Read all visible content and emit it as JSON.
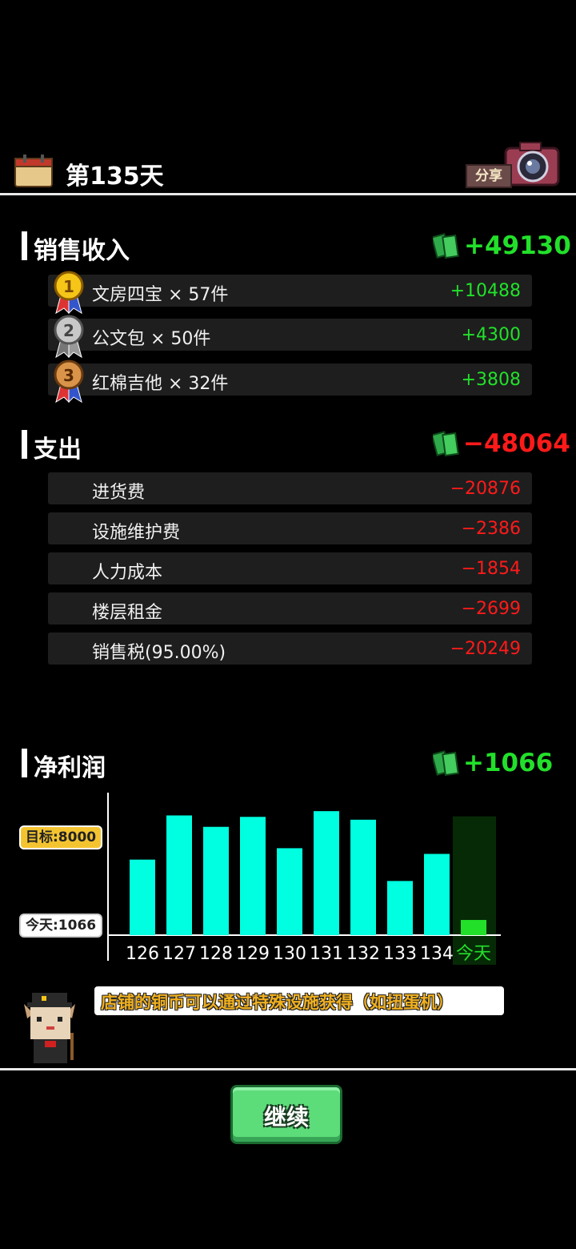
{
  "header": {
    "day_title": "第135天",
    "share_label": "分享"
  },
  "income": {
    "title": "销售收入",
    "total": "+49130",
    "items": [
      {
        "rank": "1",
        "label": "文房四宝 × 57件",
        "value": "+10488"
      },
      {
        "rank": "2",
        "label": "公文包 × 50件",
        "value": "+4300"
      },
      {
        "rank": "3",
        "label": "红棉吉他 × 32件",
        "value": "+3808"
      }
    ]
  },
  "expense": {
    "title": "支出",
    "total": "−48064",
    "items": [
      {
        "label": "进货费",
        "value": "−20876"
      },
      {
        "label": "设施维护费",
        "value": "−2386"
      },
      {
        "label": "人力成本",
        "value": "−1854"
      },
      {
        "label": "楼层租金",
        "value": "−2699"
      },
      {
        "label": "销售税(95.00%)",
        "value": "−20249"
      }
    ]
  },
  "profit": {
    "title": "净利润",
    "total": "+1066",
    "target_label": "目标:8000",
    "today_label": "今天:1066"
  },
  "chart_data": {
    "type": "bar",
    "categories": [
      "126",
      "127",
      "128",
      "129",
      "130",
      "131",
      "132",
      "133",
      "134",
      "今天"
    ],
    "values": [
      5300,
      8400,
      7600,
      8300,
      6100,
      8700,
      8100,
      3800,
      5700,
      1066
    ],
    "target": 8000,
    "colors": {
      "bar": "#00ffe0",
      "today_bar": "#22e02a",
      "today_bg": "#062a06",
      "today_label": "#22e02a"
    }
  },
  "tip": {
    "text": "店铺的铜币可以通过特殊设施获得（如扭蛋机）"
  },
  "footer": {
    "continue_label": "继续"
  }
}
